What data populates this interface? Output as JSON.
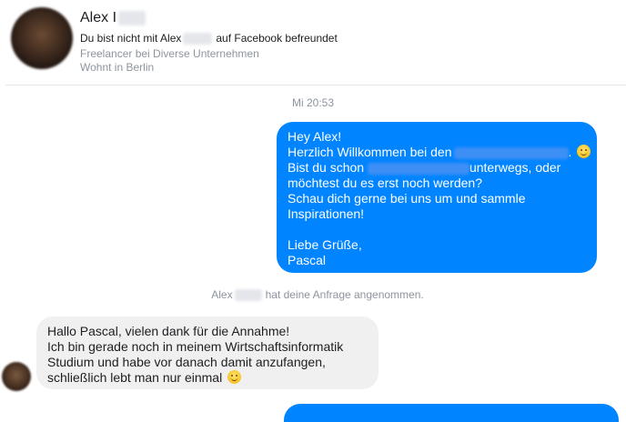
{
  "header": {
    "name": "Alex I",
    "friend_prefix": "Du bist nicht mit Alex",
    "friend_suffix": "auf Facebook befreundet",
    "job": "Freelancer bei Diverse Unternehmen",
    "location": "Wohnt in Berlin"
  },
  "timestamp": "Mi 20:53",
  "outgoing": {
    "line1": "Hey Alex!",
    "line2_pre": "Herzlich Willkommen bei den",
    "line2_post": ".",
    "line3_pre": "Bist du schon",
    "line3_post": "unterwegs, oder",
    "line4": "möchtest du es erst noch werden?",
    "line5": "Schau dich gerne bei uns um und sammle",
    "line6": "Inspirationen!",
    "line7": "Liebe Grüße,",
    "line8": "Pascal"
  },
  "system": {
    "prefix": "Alex",
    "suffix": "hat deine Anfrage angenommen."
  },
  "incoming": {
    "line1": "Hallo Pascal, vielen dank für die Annahme!",
    "line2": "Ich bin gerade noch in meinem Wirtschaftsinformatik",
    "line3": "Studium und habe vor danach damit anzufangen,",
    "line4": "schließlich lebt man nur einmal"
  },
  "icons": [
    "smile-emoji-icon"
  ],
  "colors": {
    "outgoing_bubble": "#0084ff",
    "incoming_bubble": "#f1f0f0",
    "meta_text": "#8d949e"
  }
}
